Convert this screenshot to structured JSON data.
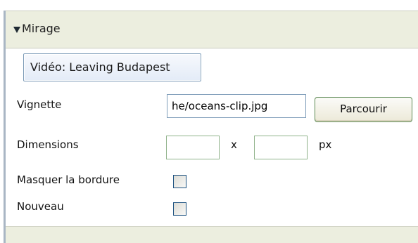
{
  "panel": {
    "title": "Mirage"
  },
  "video": {
    "button_label": "Vidéo: Leaving Budapest"
  },
  "form": {
    "thumbnail_label": "Vignette",
    "thumbnail_value": "he/oceans-clip.jpg",
    "browse_label": "Parcourir",
    "dimensions_label": "Dimensions",
    "width_value": "",
    "height_value": "",
    "separator": "x",
    "unit": "px",
    "hide_border_label": "Masquer la bordure",
    "hide_border_checked": false,
    "new_label": "Nouveau",
    "new_checked": false
  },
  "colors": {
    "header_bg": "#eceedf",
    "input_border": "#7f9db9",
    "checkbox_border": "#1c5180"
  }
}
